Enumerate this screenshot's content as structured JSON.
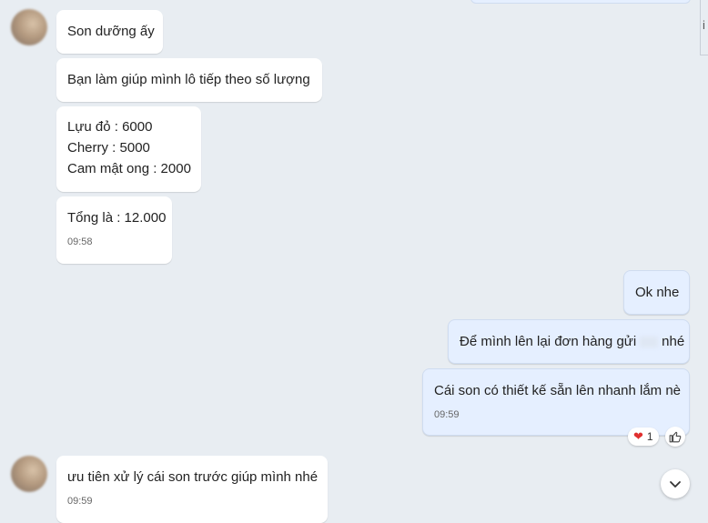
{
  "messages": {
    "m1": "Son dưỡng ấy",
    "m2": "Bạn làm giúp mình lô tiếp theo số lượng",
    "m3": [
      "Lựu đỏ : 6000",
      "Cherry : 5000",
      "Cam mật ong : 2000"
    ],
    "m4": "Tổng là : 12.000",
    "m4_time": "09:58",
    "m5": "Ok nhe",
    "m6_a": "Để mình lên lại đơn hàng gửi",
    "m6_b": "nhé",
    "m7": "Cái son có thiết kế sẵn lên nhanh lắm nè",
    "m7_time": "09:59",
    "m8": "ưu tiên xử lý cái son trước giúp mình nhé",
    "m8_time": "09:59"
  },
  "reactions": {
    "icon": "heart-icon",
    "count": "1"
  },
  "icons": {
    "like": "thumbs-up-icon",
    "scroll": "chevron-down-icon"
  },
  "colors": {
    "incoming_bubble": "#ffffff",
    "outgoing_bubble": "#e5efff",
    "background": "#e8edf2",
    "heart": "#e0302f"
  },
  "edge": {
    "partial_text": "i"
  }
}
